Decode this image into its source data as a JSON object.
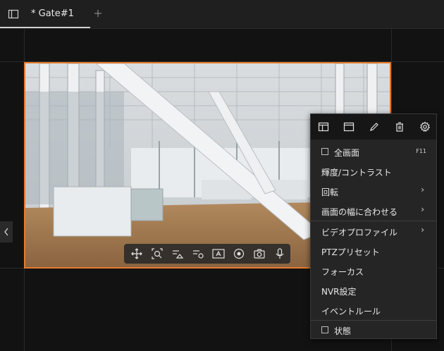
{
  "tab": {
    "title": "* Gate#1"
  },
  "icons": {
    "layout": "layout-icon",
    "add": "plus-icon",
    "left": "chevron-left-icon"
  },
  "colors": {
    "selection_border": "#e57a2e"
  },
  "toolbar": {
    "buttons": [
      "move-icon",
      "zoom-icon",
      "image-settings-icon",
      "video-settings-icon",
      "text-overlay-icon",
      "record-icon",
      "snapshot-icon",
      "microphone-icon"
    ]
  },
  "menu": {
    "top_icons": [
      "split-layout-icon",
      "window-icon",
      "pencil-icon",
      "trash-icon",
      "gear-icon"
    ],
    "items": [
      {
        "label": "全画面",
        "shortcut": "F11"
      },
      {
        "label": "輝度/コントラスト"
      },
      {
        "label": "回転"
      },
      {
        "label": "画面の幅に合わせる"
      },
      {
        "label": "ビデオプロファイル"
      },
      {
        "label": "PTZプリセット"
      },
      {
        "label": "フォーカス"
      },
      {
        "label": "NVR設定"
      },
      {
        "label": "イベントルール"
      },
      {
        "label": "状態"
      }
    ]
  }
}
